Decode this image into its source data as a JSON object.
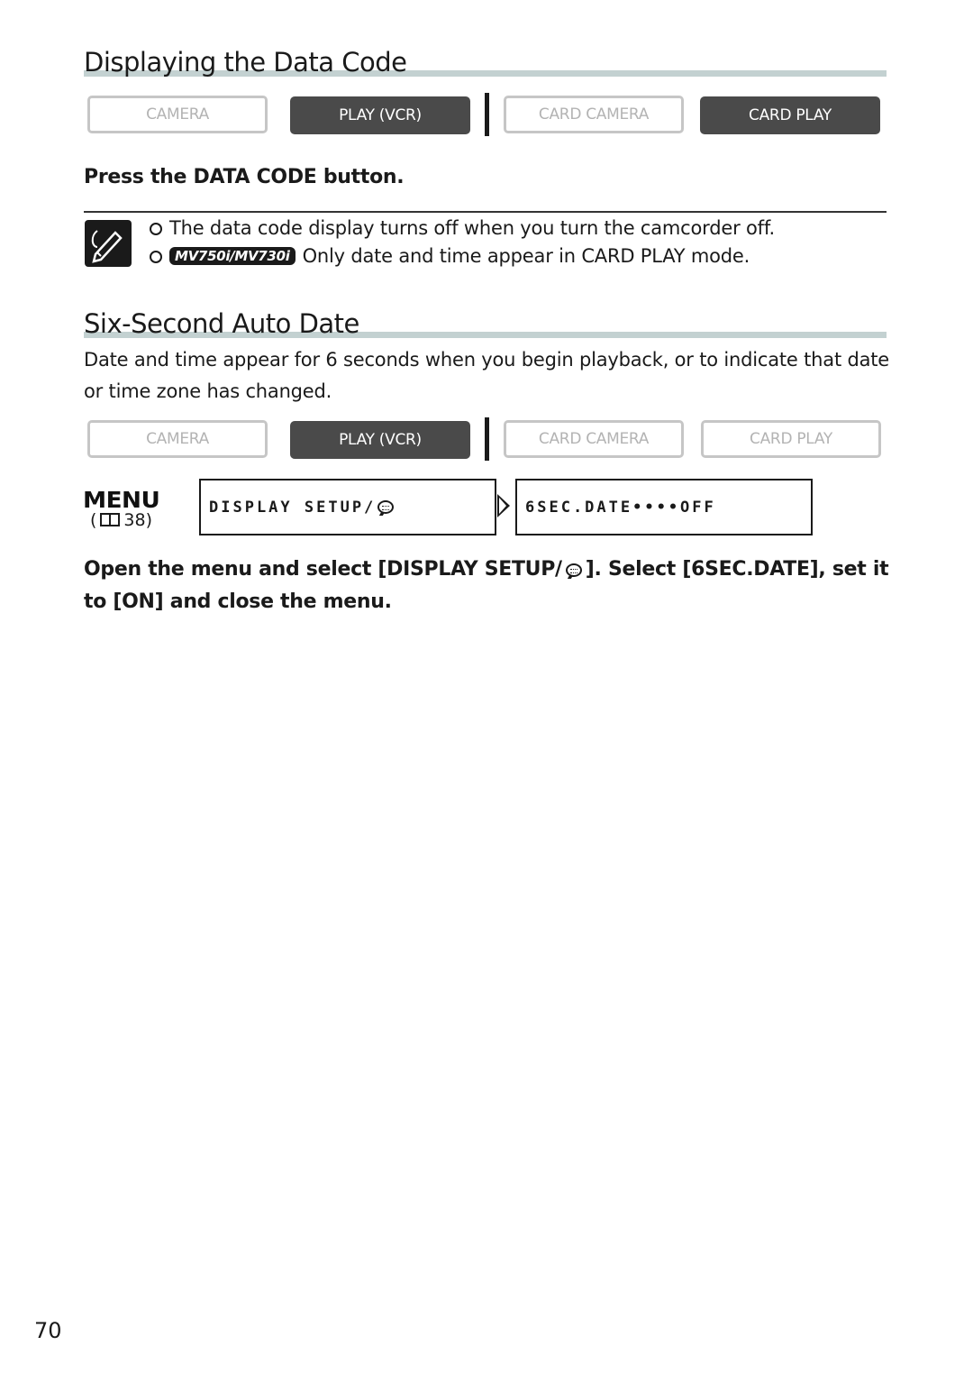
{
  "section1": {
    "title": "Displaying the Data Code",
    "modes": [
      {
        "label": "CAMERA",
        "active": false
      },
      {
        "label": "PLAY (VCR)",
        "active": true
      },
      {
        "label": "CARD CAMERA",
        "active": false
      },
      {
        "label": "CARD PLAY",
        "active": true
      }
    ],
    "step": "Press the DATA CODE button.",
    "notes": [
      {
        "text": "The data code display turns off when you turn the camcorder off."
      },
      {
        "badge": "MV750i/MV730i",
        "text": "Only date and time appear in CARD PLAY mode."
      }
    ]
  },
  "section2": {
    "title": "Six-Second Auto Date",
    "description": "Date and time appear for 6 seconds when you begin playback, or to indicate that date or time zone has changed.",
    "modes": [
      {
        "label": "CAMERA",
        "active": false
      },
      {
        "label": "PLAY (VCR)",
        "active": true
      },
      {
        "label": "CARD CAMERA",
        "active": false
      },
      {
        "label": "CARD PLAY",
        "active": false
      }
    ],
    "menu": {
      "logo": "MENU",
      "ref_open": "(",
      "ref_page": "38)",
      "menu_item": "DISPLAY SETUP/",
      "setting": "6SEC.DATE••••OFF"
    },
    "step_line1": "Open the menu and select [DISPLAY SETUP/",
    "step_line1b": "]. Select [6SEC.DATE], set it",
    "step_line2": "to [ON] and close the menu."
  },
  "page_number": "70"
}
